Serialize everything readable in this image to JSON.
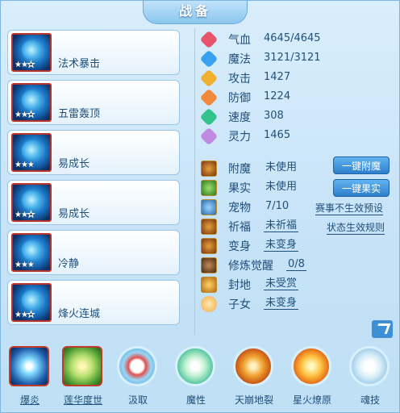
{
  "title": "战备",
  "skills": [
    {
      "name": "法术暴击",
      "stars": 2
    },
    {
      "name": "五雷轰顶",
      "stars": 2
    },
    {
      "name": "易成长",
      "stars": 3
    },
    {
      "name": "易成长",
      "stars": 2
    },
    {
      "name": "冷静",
      "stars": 3
    },
    {
      "name": "烽火连城",
      "stars": 2
    }
  ],
  "stats": [
    {
      "label": "气血",
      "value": "4645/4645",
      "color": "#e8546a",
      "icon": "heart-icon"
    },
    {
      "label": "魔法",
      "value": "3121/3121",
      "color": "#3aa0f0",
      "icon": "diamond-icon"
    },
    {
      "label": "攻击",
      "value": "1427",
      "color": "#f0b030",
      "icon": "sword-icon"
    },
    {
      "label": "防御",
      "value": "1224",
      "color": "#f08a3a",
      "icon": "shield-icon"
    },
    {
      "label": "速度",
      "value": "308",
      "color": "#32c48a",
      "icon": "lightning-icon"
    },
    {
      "label": "灵力",
      "value": "1465",
      "color": "#c08ae0",
      "icon": "spirit-icon"
    }
  ],
  "status": [
    {
      "label": "附魔",
      "value": "未使用"
    },
    {
      "label": "果实",
      "value": "未使用"
    },
    {
      "label": "宠物",
      "value": "7/10"
    },
    {
      "label": "祈福",
      "value": "未祈福"
    },
    {
      "label": "变身",
      "value": "未变身"
    },
    {
      "label": "修炼觉醒",
      "value": "0/8"
    },
    {
      "label": "封地",
      "value": "未受赏"
    },
    {
      "label": "子女",
      "value": "未变身"
    }
  ],
  "buttons": {
    "enchant": "一键附魔",
    "fruit": "一键果实",
    "no_preset": "赛事不生效预设",
    "rules": "状态生效规则"
  },
  "skillbar": [
    {
      "label": "爆炎",
      "icon": "explosion-icon"
    },
    {
      "label": "莲华度世",
      "icon": "lotus-hand-icon"
    },
    {
      "label": "汲取",
      "icon": "absorb-icon"
    },
    {
      "label": "魔性",
      "icon": "meditation-icon"
    },
    {
      "label": "天崩地裂",
      "icon": "earth-crack-icon"
    },
    {
      "label": "星火燎原",
      "icon": "starfire-icon"
    },
    {
      "label": "魂技",
      "icon": "soul-skill-icon"
    }
  ]
}
